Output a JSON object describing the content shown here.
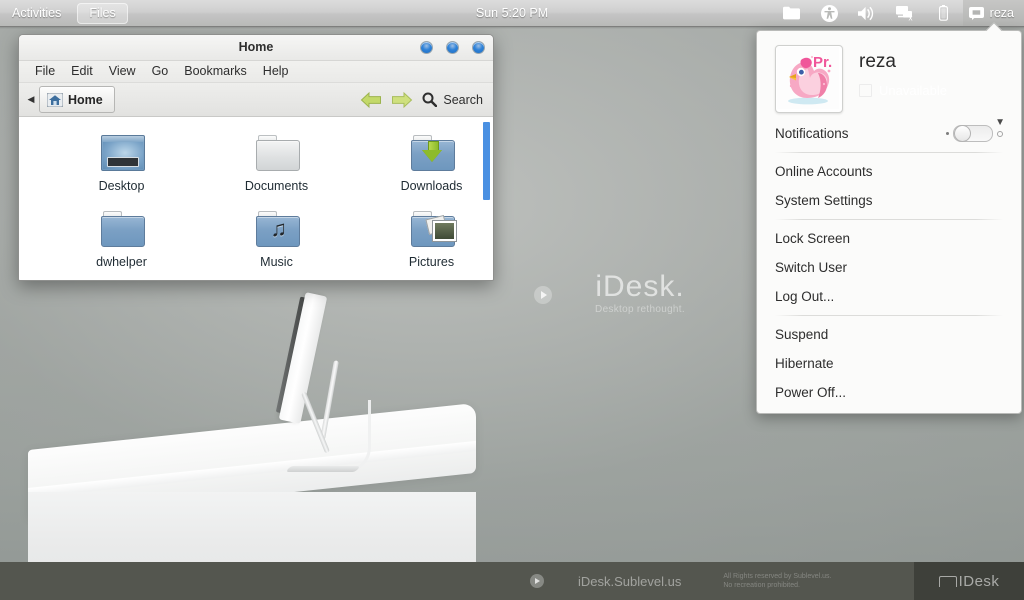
{
  "topbar": {
    "activities": "Activities",
    "app_button": "Files",
    "clock": "Sun  5:20 PM",
    "status_icons": [
      {
        "name": "files-tray-icon",
        "label": "Files"
      },
      {
        "name": "accessibility-icon",
        "label": "Universal Access"
      },
      {
        "name": "volume-icon",
        "label": "Volume"
      },
      {
        "name": "network-offline-icon",
        "label": "Network"
      },
      {
        "name": "battery-icon",
        "label": "Battery"
      }
    ],
    "username": "reza"
  },
  "usermenu": {
    "name": "reza",
    "avatar_text": "Pr.",
    "status": "Unavailable",
    "notifications_label": "Notifications",
    "notifications_state": "off",
    "items_group1": [
      {
        "label": "Online Accounts"
      },
      {
        "label": "System Settings"
      }
    ],
    "items_group2": [
      {
        "label": "Lock Screen"
      },
      {
        "label": "Switch User"
      },
      {
        "label": "Log Out..."
      }
    ],
    "items_group3": [
      {
        "label": "Suspend"
      },
      {
        "label": "Hibernate"
      },
      {
        "label": "Power Off..."
      }
    ]
  },
  "filemanager": {
    "title": "Home",
    "menu": [
      "File",
      "Edit",
      "View",
      "Go",
      "Bookmarks",
      "Help"
    ],
    "breadcrumb": "Home",
    "search_label": "Search",
    "files": [
      {
        "label": "Desktop",
        "icon": "desktop-folder-icon"
      },
      {
        "label": "Documents",
        "icon": "documents-folder-icon"
      },
      {
        "label": "Downloads",
        "icon": "downloads-folder-icon"
      },
      {
        "label": "dwhelper",
        "icon": "folder-icon"
      },
      {
        "label": "Music",
        "icon": "music-folder-icon"
      },
      {
        "label": "Pictures",
        "icon": "pictures-folder-icon"
      }
    ]
  },
  "wallpaper": {
    "brand_title": "iDesk.",
    "brand_sub": "Desktop rethought.",
    "footer_url": "iDesk.Sublevel.us",
    "footer_rights_line1": "All Rights reserved by Sublevel.us.",
    "footer_rights_line2": "No recreation prohibited.",
    "footer_logo": "IDesk"
  },
  "colors": {
    "accent_blue": "#2f82d8",
    "scrollbar_blue": "#4a90e2",
    "folder_blue": "#7ba0c4",
    "download_green": "#8dbb2a"
  }
}
